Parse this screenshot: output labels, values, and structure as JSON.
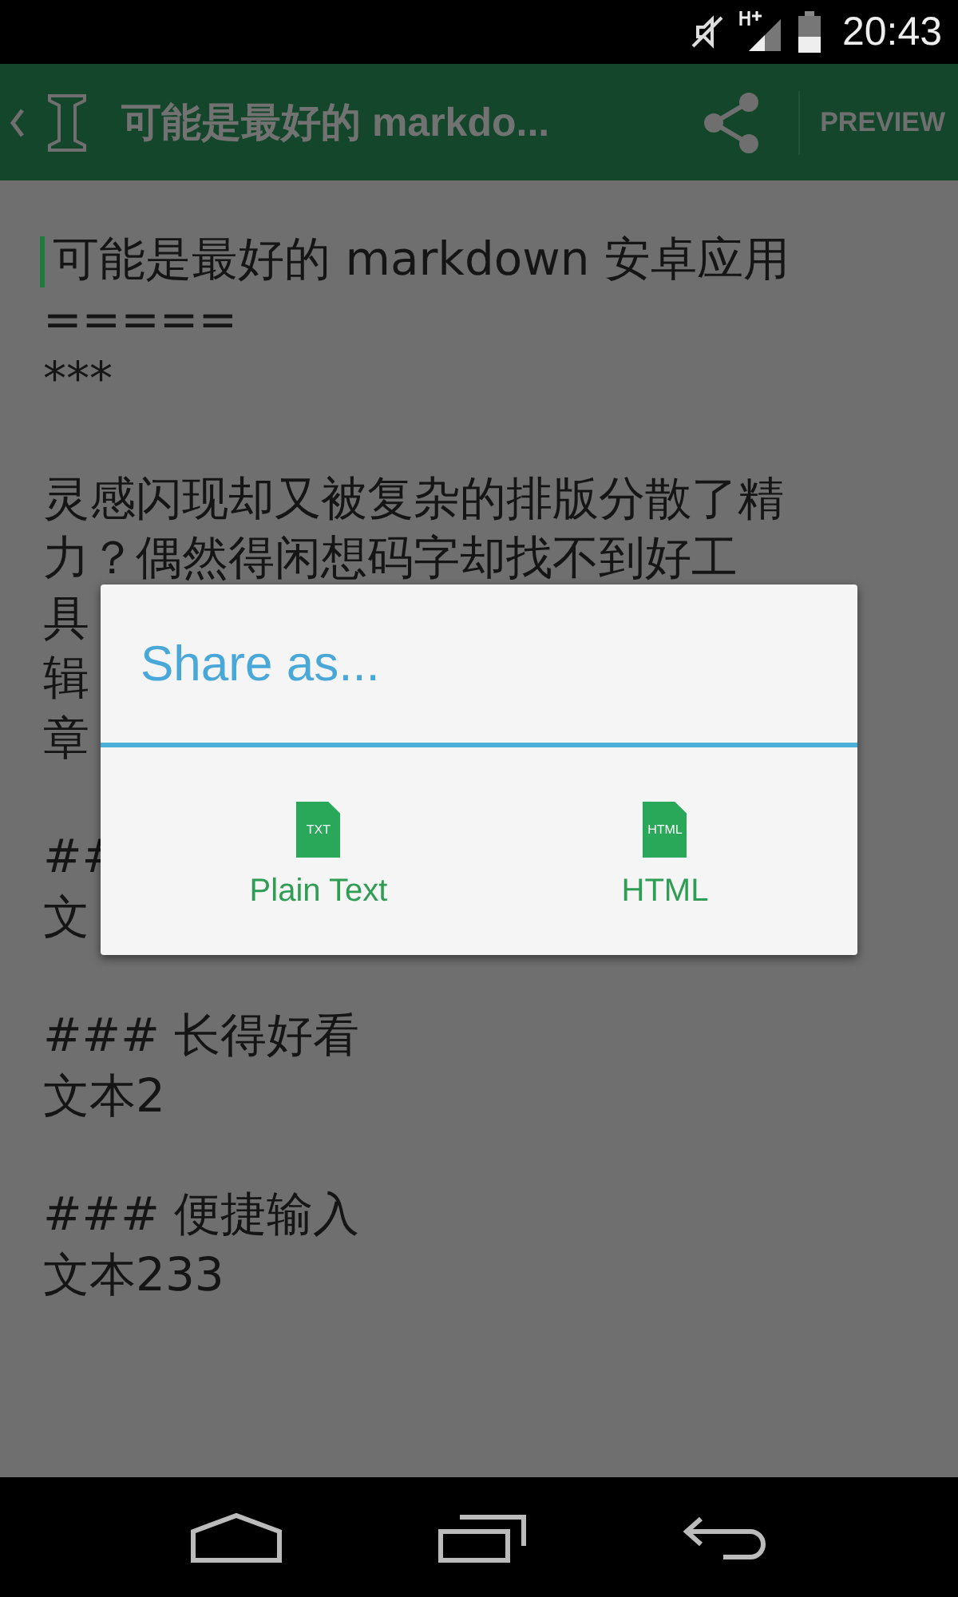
{
  "status_bar": {
    "time": "20:43"
  },
  "toolbar": {
    "title": "可能是最好的 markdo...",
    "action": "PREVIEW"
  },
  "editor": {
    "blocks": [
      {
        "lines": [
          {
            "text": "可能是最好的 markdown 安卓应用",
            "cursor": true
          },
          {
            "text": "=====",
            "cursor": false
          },
          {
            "text": "***",
            "cursor": false
          }
        ]
      },
      {
        "lines": [
          {
            "text": "灵感闪现却又被复杂的排版分散了精",
            "cursor": false
          },
          {
            "text": "力？偶然得闲想码字却找不到好工",
            "cursor": false
          },
          {
            "text": "具",
            "cursor": false
          },
          {
            "text": "辑",
            "cursor": false
          },
          {
            "text": "章",
            "cursor": false
          }
        ]
      },
      {
        "lines": [
          {
            "text": "##",
            "cursor": false
          },
          {
            "text": "文",
            "cursor": false
          }
        ]
      },
      {
        "lines": [
          {
            "text": "### 长得好看",
            "cursor": false
          },
          {
            "text": "文本2",
            "cursor": false
          }
        ]
      },
      {
        "lines": [
          {
            "text": "### 便捷输入",
            "cursor": false
          },
          {
            "text": "文本233",
            "cursor": false
          }
        ]
      }
    ]
  },
  "dialog": {
    "title": "Share as...",
    "options": [
      {
        "label": "Plain Text",
        "icon_text": "TXT"
      },
      {
        "label": "HTML",
        "icon_text": "HTML"
      }
    ]
  }
}
